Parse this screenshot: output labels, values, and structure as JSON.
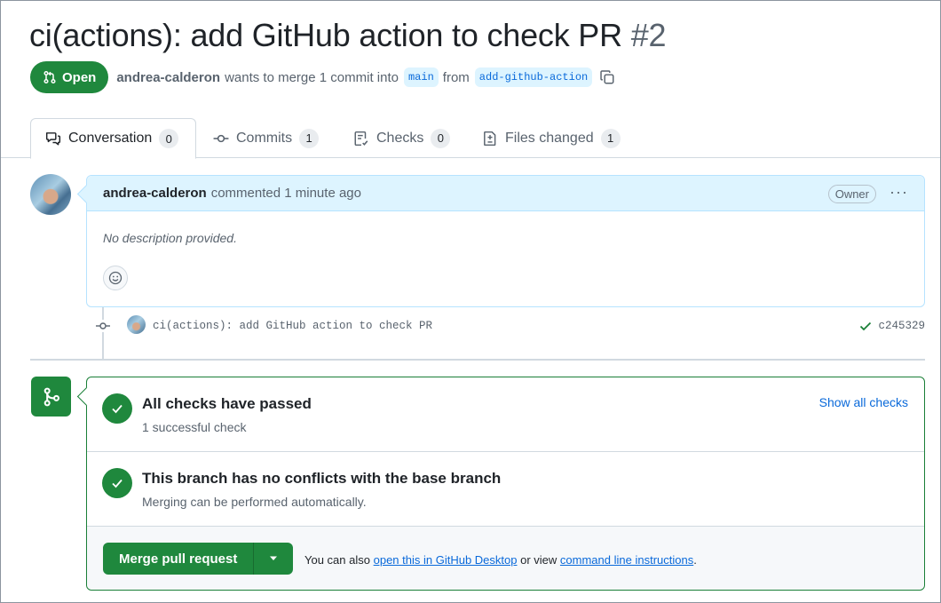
{
  "pr": {
    "title": "ci(actions): add GitHub action to check PR",
    "number": "#2",
    "state": "Open",
    "author": "andrea-calderon",
    "merge_text": "wants to merge 1 commit into",
    "base_branch": "main",
    "from_text": "from",
    "head_branch": "add-github-action"
  },
  "tabs": [
    {
      "label": "Conversation",
      "count": "0",
      "icon": "comment-discussion-icon"
    },
    {
      "label": "Commits",
      "count": "1",
      "icon": "git-commit-icon"
    },
    {
      "label": "Checks",
      "count": "0",
      "icon": "checklist-icon"
    },
    {
      "label": "Files changed",
      "count": "1",
      "icon": "file-diff-icon"
    }
  ],
  "comment": {
    "author": "andrea-calderon",
    "meta": "commented 1 minute ago",
    "badge": "Owner",
    "more": "···",
    "body": "No description provided."
  },
  "commit": {
    "message": "ci(actions): add GitHub action to check PR",
    "sha": "c245329"
  },
  "checks": {
    "title": "All checks have passed",
    "subtitle": "1 successful check",
    "show_all": "Show all checks"
  },
  "conflicts": {
    "title": "This branch has no conflicts with the base branch",
    "subtitle": "Merging can be performed automatically."
  },
  "merge": {
    "button": "Merge pull request",
    "note_prefix": "You can also",
    "desktop_link": "open this in GitHub Desktop",
    "note_mid": "or view",
    "cli_link": "command line instructions",
    "note_suffix": "."
  },
  "colors": {
    "open_green": "#1f883d",
    "link_blue": "#0969da",
    "comment_header_bg": "#ddf4ff"
  }
}
